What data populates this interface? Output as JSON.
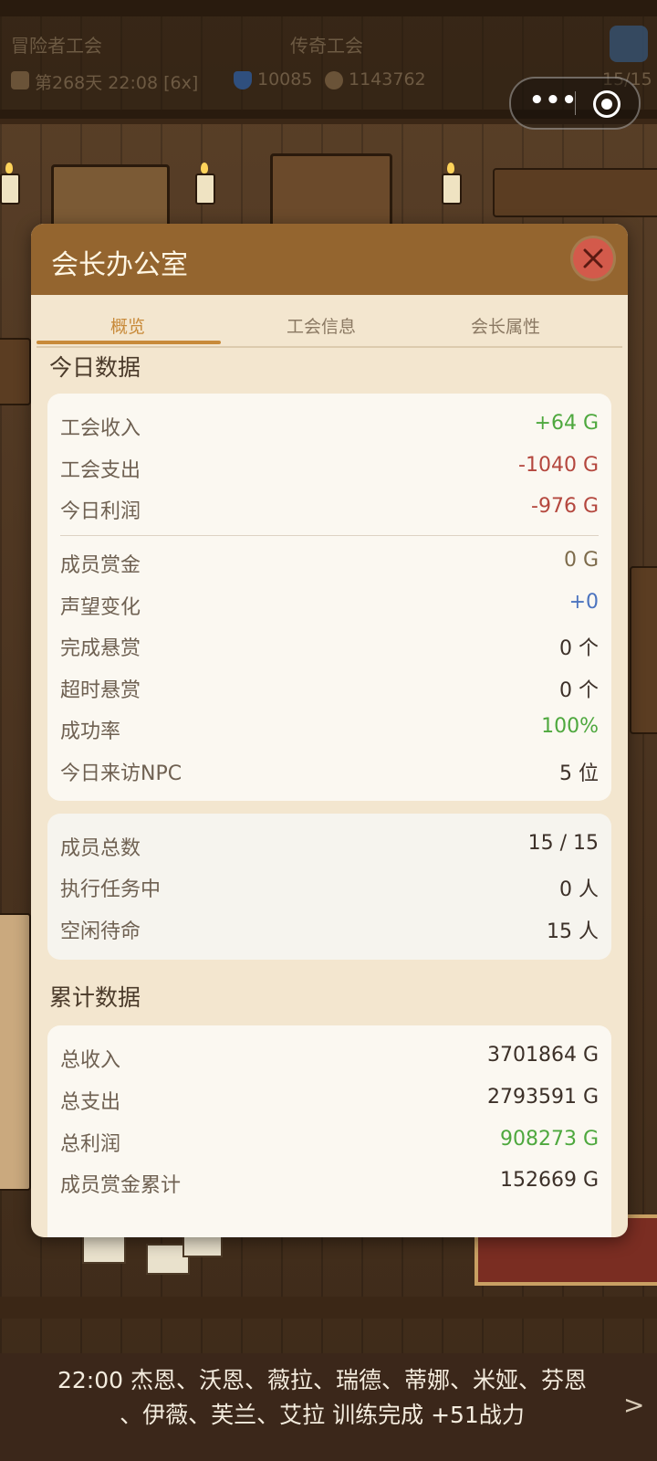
{
  "header": {
    "guild_type": "冒险者工会",
    "guild_rank": "传奇工会",
    "day_time": "第268天 22:08 [6x]",
    "reputation": "10085",
    "gold": "1143762",
    "members": "15/15"
  },
  "modal": {
    "title": "会长办公室",
    "tabs": [
      "概览",
      "工会信息",
      "会长属性"
    ],
    "active_tab": 0,
    "today_section": "今日数据",
    "today_finance": [
      {
        "label": "工会收入",
        "value": "+64 G",
        "tone": "green"
      },
      {
        "label": "工会支出",
        "value": "-1040 G",
        "tone": "red"
      },
      {
        "label": "今日利润",
        "value": "-976 G",
        "tone": "red"
      }
    ],
    "today_stats": [
      {
        "label": "成员赏金",
        "value": "0 G",
        "tone": "olive"
      },
      {
        "label": "声望变化",
        "value": "+0",
        "tone": "blue"
      },
      {
        "label": "完成悬赏",
        "value": "0 个",
        "tone": "normal"
      },
      {
        "label": "超时悬赏",
        "value": "0 个",
        "tone": "normal"
      },
      {
        "label": "成功率",
        "value": "100%",
        "tone": "green"
      },
      {
        "label": "今日来访NPC",
        "value": "5 位",
        "tone": "normal"
      }
    ],
    "member_stats": [
      {
        "label": "成员总数",
        "value": "15 / 15",
        "tone": "normal"
      },
      {
        "label": "执行任务中",
        "value": "0 人",
        "tone": "normal"
      },
      {
        "label": "空闲待命",
        "value": "15 人",
        "tone": "normal"
      }
    ],
    "cumulative_section": "累计数据",
    "cumulative": [
      {
        "label": "总收入",
        "value": "3701864 G",
        "tone": "normal"
      },
      {
        "label": "总支出",
        "value": "2793591 G",
        "tone": "normal"
      },
      {
        "label": "总利润",
        "value": "908273 G",
        "tone": "green"
      },
      {
        "label": "成员赏金累计",
        "value": "152669 G",
        "tone": "normal"
      }
    ]
  },
  "ticker": {
    "line1": "22:00 杰恩、沃恩、薇拉、瑞德、蒂娜、米娅、芬恩",
    "line2": "、伊薇、芙兰、艾拉 训练完成 +51战力",
    "arrow": ">"
  }
}
